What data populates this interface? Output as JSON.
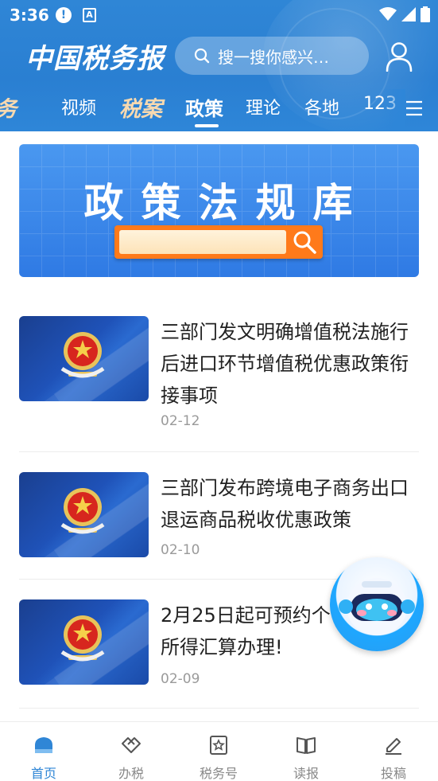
{
  "status_bar": {
    "time": "3:36",
    "alert": "!",
    "app_badge": "A"
  },
  "header": {
    "logo": "中国税务报",
    "search_placeholder": "搜一搜你感兴…",
    "tabs": [
      "务",
      "视频",
      "税案",
      "政策",
      "理论",
      "各地",
      "123"
    ],
    "active_tab": "政策"
  },
  "banner": {
    "title": "政策法规库"
  },
  "news": [
    {
      "title": "三部门发文明确增值税法施行后进口环节增值税优惠政策衔接事项",
      "date": "02-12"
    },
    {
      "title": "三部门发布跨境电子商务出口退运商品税收优惠政策",
      "date": "02-10"
    },
    {
      "title": "2月25日起可预约个人所得汇算办理!",
      "title_visible": "2月25日起可预约个",
      "title_line2": "所得汇算办理!",
      "date": "02-09"
    }
  ],
  "bottom_nav": [
    {
      "label": "首页",
      "active": true
    },
    {
      "label": "办税",
      "active": false
    },
    {
      "label": "税务号",
      "active": false
    },
    {
      "label": "读报",
      "active": false
    },
    {
      "label": "投稿",
      "active": false
    }
  ],
  "colors": {
    "primary": "#2f86d6",
    "banner_orange": "#ff7a1a",
    "text": "#222222",
    "muted": "#9a9a9a"
  }
}
